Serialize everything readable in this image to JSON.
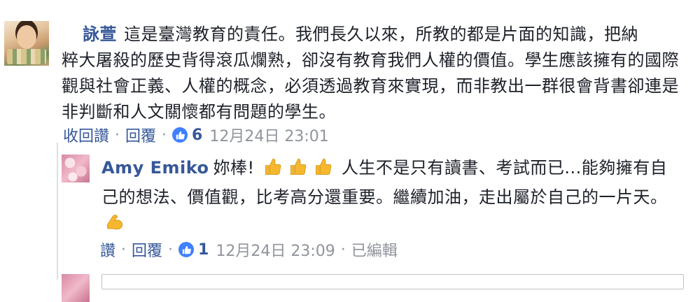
{
  "comment": {
    "author": "詠萱",
    "text_line1": "這是臺灣教育的責任。我們長久以來，所教的都是片面的知識，把納",
    "text_rest": "粹大屠殺的歷史背得滾瓜爛熟，卻沒有教育我們人權的價值。學生應該擁有的國際觀與社會正義、人權的概念，必須透過教育來實現，而非教出一群很會背書卻連是非判斷和人文關懷都有問題的學生。",
    "unlike_label": "收回讚",
    "reply_label": "回覆",
    "like_count": "6",
    "timestamp": "12月24日 23:01"
  },
  "reply": {
    "author": "Amy Emiko",
    "text_before": "妳棒!",
    "text_after": "人生不是只有讀書、考試而已...能夠擁有自己的想法、價值觀，比考高分還重要。繼續加油，走出屬於自己的一片天。",
    "like_label": "讚",
    "reply_label": "回覆",
    "like_count": "1",
    "timestamp": "12月24日 23:09",
    "edited_label": "已編輯",
    "emojis": [
      "thumbs-up",
      "thumbs-up",
      "thumbs-up",
      "flexed-biceps"
    ]
  },
  "colors": {
    "link": "#365899",
    "meta_gray": "#90949c",
    "like_blue": "#4080ff",
    "emoji_yellow": "#f5b72e"
  }
}
